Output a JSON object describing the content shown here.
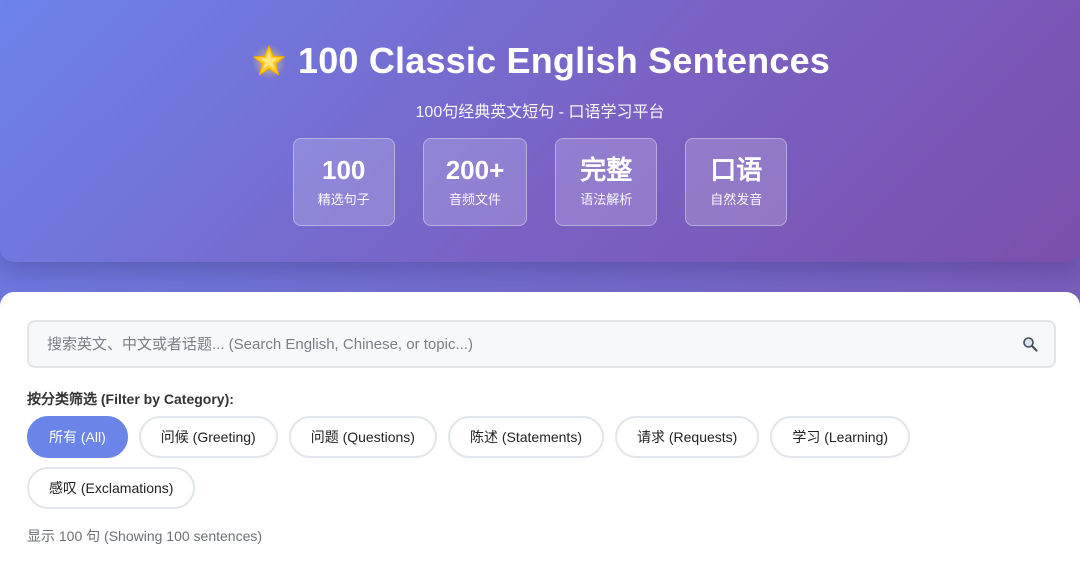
{
  "header": {
    "title": "100 Classic English Sentences",
    "subtitle": "100句经典英文短句 - 口语学习平台",
    "icon": "star-icon",
    "stats": [
      {
        "value": "100",
        "label": "精选句子"
      },
      {
        "value": "200+",
        "label": "音频文件"
      },
      {
        "value": "完整",
        "label": "语法解析"
      },
      {
        "value": "口语",
        "label": "自然发音"
      }
    ]
  },
  "search": {
    "value": "",
    "placeholder": "搜索英文、中文或者话题... (Search English, Chinese, or topic...)",
    "icon": "search-icon"
  },
  "filters": {
    "label": "按分类筛选 (Filter by Category):",
    "selected": "所有 (All)",
    "options": [
      "所有 (All)",
      "问候 (Greeting)",
      "问题 (Questions)",
      "陈述 (Statements)",
      "请求 (Requests)",
      "学习 (Learning)",
      "感叹 (Exclamations)"
    ]
  },
  "results": {
    "count_text": "显示 100 句 (Showing 100 sentences)"
  },
  "colors": {
    "accent": "#6a84e8",
    "hero_start": "#6c83ea",
    "hero_end": "#7a4fab"
  }
}
